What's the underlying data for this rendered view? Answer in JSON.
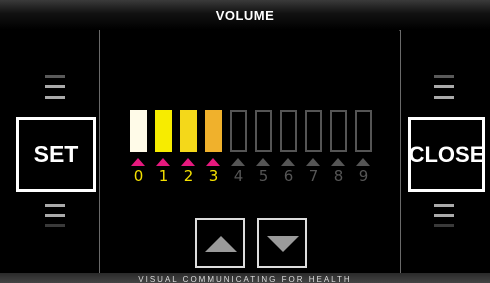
{
  "title": "VOLUME",
  "buttons": {
    "set": "SET",
    "close": "CLOSE",
    "up": "up",
    "down": "down"
  },
  "volume": {
    "level": 3,
    "labels": [
      "0",
      "1",
      "2",
      "3",
      "4",
      "5",
      "6",
      "7",
      "8",
      "9"
    ],
    "active_colors": [
      "#fffbe8",
      "#f7ec00",
      "#f4d81a",
      "#f0b12c"
    ],
    "inactive_color": "#555555",
    "indicator_color": "#e6197f",
    "label_active_color": "#f5e100"
  },
  "footer": "VISUAL COMMUNICATING FOR HEALTH"
}
